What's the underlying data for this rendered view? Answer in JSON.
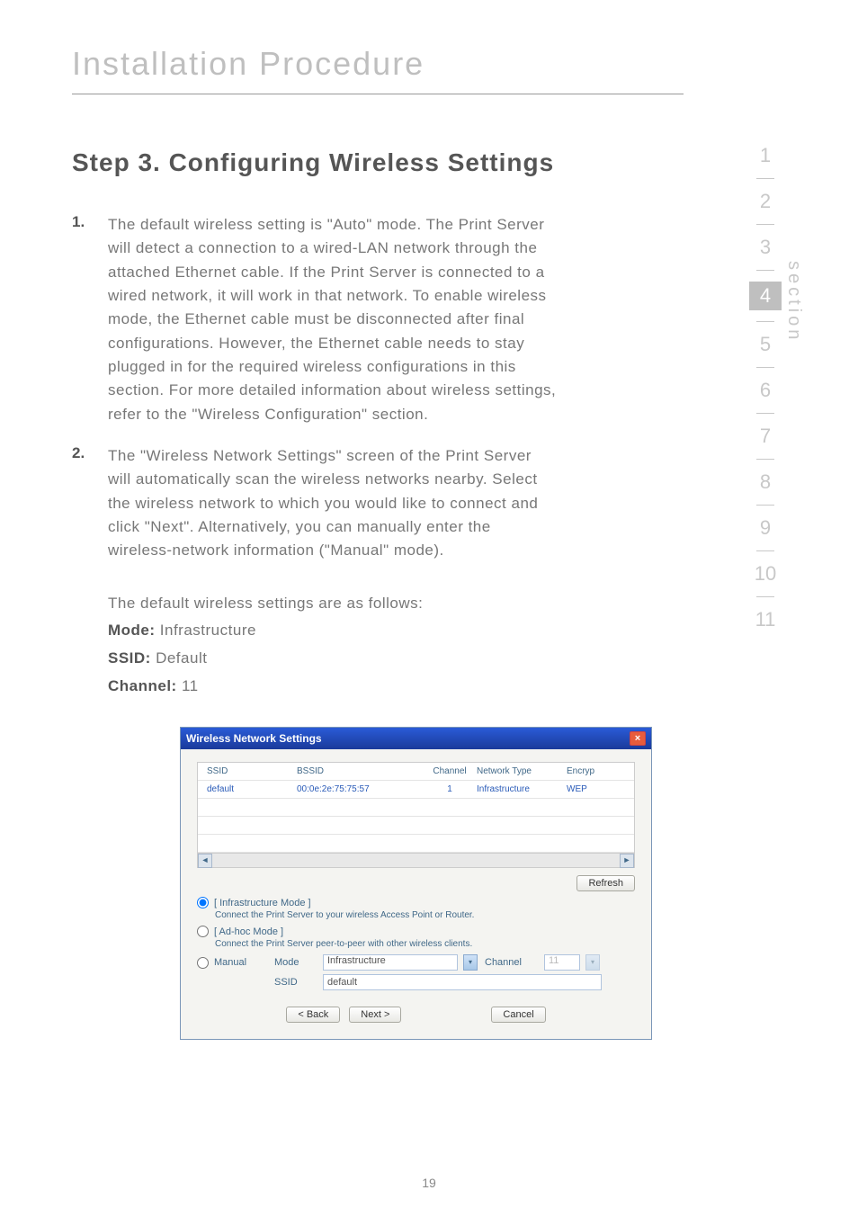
{
  "header": {
    "chapter": "Installation Procedure"
  },
  "main": {
    "heading": "Step 3.  Configuring Wireless Settings",
    "items": [
      {
        "num": "1.",
        "text": "The default wireless setting is \"Auto\" mode. The Print Server will detect a connection to a wired-LAN network through the attached Ethernet cable. If the Print Server is connected to a wired network, it will work in that network. To enable wireless mode, the Ethernet cable must be disconnected after final configurations. However, the Ethernet cable needs to stay plugged in for the required wireless configurations in this section. For more detailed information about wireless settings, refer to the \"Wireless Configuration\" section."
      },
      {
        "num": "2.",
        "text": "The \"Wireless Network Settings\" screen of the Print Server will automatically scan the wireless networks nearby. Select the wireless network to which you would like to connect and click \"Next\". Alternatively, you can manually enter the wireless-network information (\"Manual\" mode)."
      }
    ],
    "defaults_intro": "The default wireless settings are as follows:",
    "defaults": {
      "mode_label": "Mode:",
      "mode_value": "Infrastructure",
      "ssid_label": "SSID:",
      "ssid_value": "Default",
      "channel_label": "Channel:",
      "channel_value": "11"
    }
  },
  "sidebar": {
    "label": "section",
    "tabs": [
      "1",
      "2",
      "3",
      "4",
      "5",
      "6",
      "7",
      "8",
      "9",
      "10",
      "11"
    ],
    "active": "4"
  },
  "dialog": {
    "title": "Wireless Network Settings",
    "close": "×",
    "columns": {
      "ssid": "SSID",
      "bssid": "BSSID",
      "channel": "Channel",
      "type": "Network Type",
      "enc": "Encryp"
    },
    "row": {
      "ssid": "default",
      "bssid": "00:0e:2e:75:75:57",
      "channel": "1",
      "type": "Infrastructure",
      "enc": "WEP"
    },
    "refresh": "Refresh",
    "modes": {
      "infra_label": "[ Infrastructure Mode ]",
      "infra_desc": "Connect the Print Server to your wireless Access Point or Router.",
      "adhoc_label": "[ Ad-hoc Mode ]",
      "adhoc_desc": "Connect the Print Server peer-to-peer with other wireless clients.",
      "manual_label": "Manual",
      "mode_lbl": "Mode",
      "mode_val": "Infrastructure",
      "channel_lbl": "Channel",
      "channel_val": "11",
      "ssid_lbl": "SSID",
      "ssid_val": "default"
    },
    "buttons": {
      "back": "< Back",
      "next": "Next >",
      "cancel": "Cancel"
    }
  },
  "page_number": "19"
}
